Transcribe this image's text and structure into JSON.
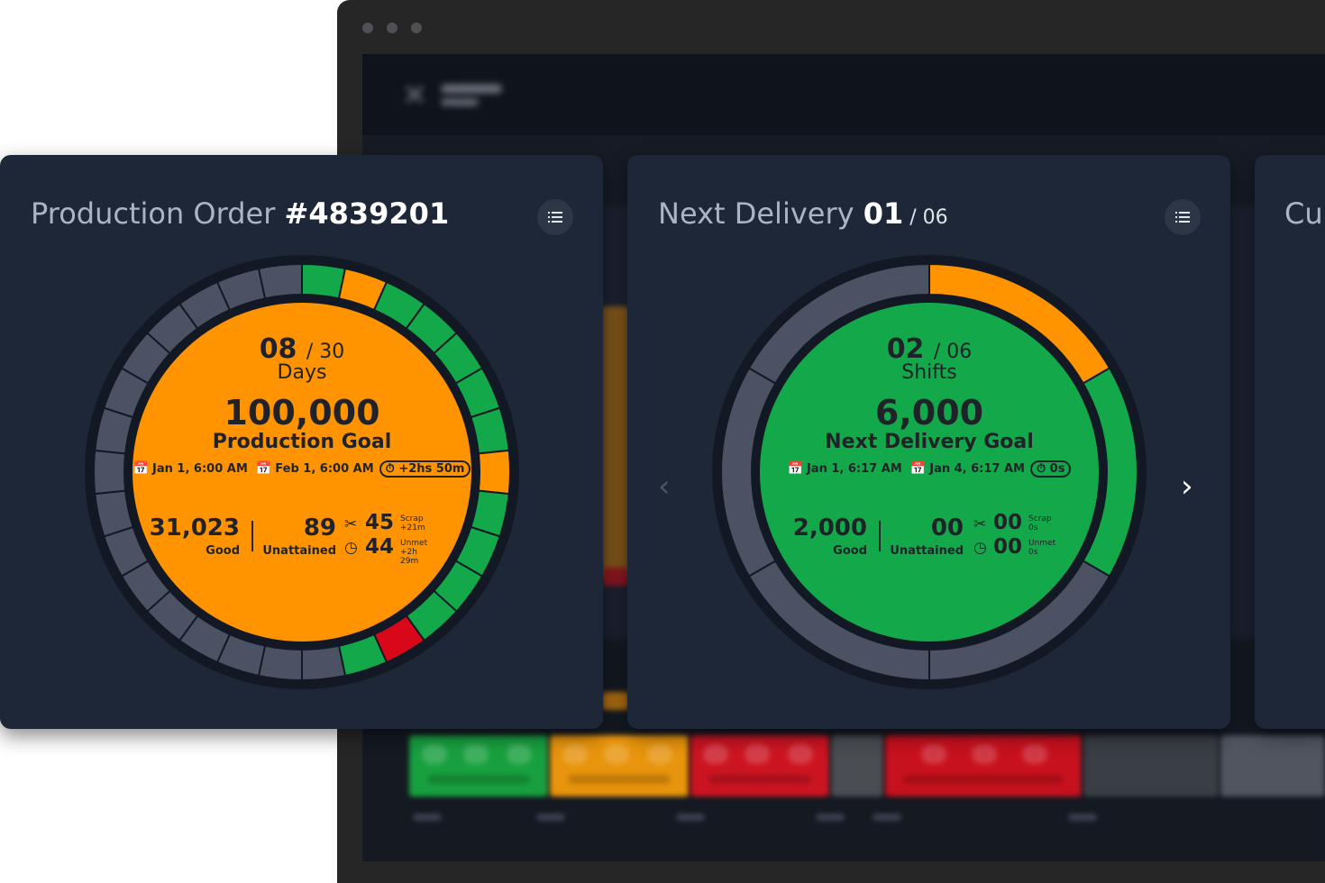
{
  "colors": {
    "orange": "#ff9400",
    "green": "#13a84a",
    "red": "#d8071a",
    "gray": "#4b5263",
    "card": "#1e2737"
  },
  "card1": {
    "title_prefix": "Production Order ",
    "title_id": "#4839201",
    "menu_icon": "list-icon",
    "period_value": "08",
    "period_total": "/ 30",
    "period_unit": "Days",
    "goal_value": "100,000",
    "goal_label": "Production Goal",
    "start": "Jan 1, 6:00 AM",
    "end": "Feb 1, 6:00 AM",
    "delay": "+2hs 50m",
    "good_value": "31,023",
    "good_label": "Good",
    "unattained_value": "89",
    "unattained_label": "Unattained",
    "scrap_value": "45",
    "scrap_label": "Scrap",
    "scrap_delta": "+21m",
    "unmet_value": "44",
    "unmet_label": "Unmet",
    "unmet_delta": "+2h 29m",
    "ring_segments": [
      "green",
      "orange",
      "green",
      "green",
      "green",
      "green",
      "green",
      "orange",
      "green",
      "green",
      "green",
      "green",
      "red",
      "green",
      "gray",
      "gray",
      "gray",
      "gray",
      "gray",
      "gray",
      "gray",
      "gray",
      "gray",
      "gray",
      "gray",
      "gray",
      "gray",
      "gray",
      "gray",
      "gray"
    ]
  },
  "card2": {
    "title_prefix": "Next Delivery ",
    "title_value": "01",
    "title_total": " / 06",
    "menu_icon": "list-icon",
    "period_value": "02",
    "period_total": "/ 06",
    "period_unit": "Shifts",
    "goal_value": "6,000",
    "goal_label": "Next Delivery Goal",
    "start": "Jan 1, 6:17 AM",
    "end": "Jan 4, 6:17 AM",
    "delay": "0s",
    "good_value": "2,000",
    "good_label": "Good",
    "unattained_value": "00",
    "unattained_label": "Unattained",
    "scrap_value": "00",
    "scrap_label": "Scrap",
    "scrap_delta": "0s",
    "unmet_value": "00",
    "unmet_label": "Unmet",
    "unmet_delta": "0s",
    "ring_segments": [
      "orange",
      "green",
      "gray",
      "gray",
      "gray",
      "gray"
    ],
    "prev_icon": "chevron-left-icon",
    "next_icon": "chevron-right-icon"
  },
  "card3": {
    "title_partial": "Cu"
  }
}
